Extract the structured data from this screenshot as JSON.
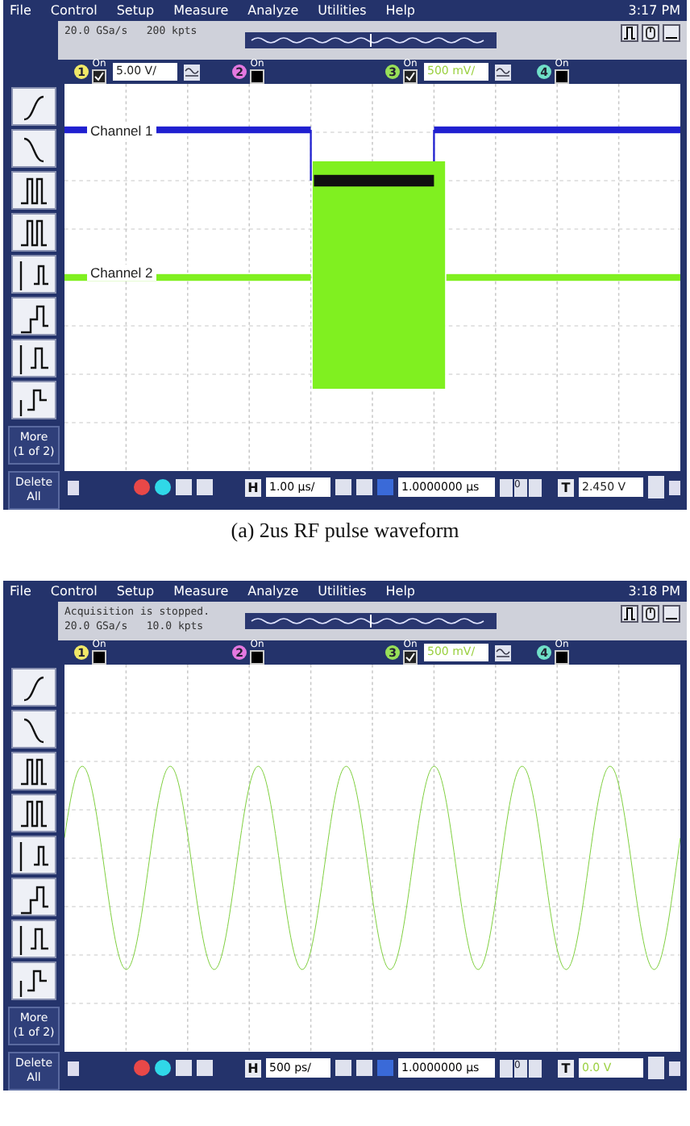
{
  "scopes": [
    {
      "menu": [
        "File",
        "Control",
        "Setup",
        "Measure",
        "Analyze",
        "Utilities",
        "Help"
      ],
      "time": "3:17 PM",
      "status_lines": [
        "20.0 GSa/s   200 kpts"
      ],
      "channels": [
        {
          "number": "1",
          "label": "On",
          "checked": true,
          "color": "#f0e868",
          "scale": {
            "text": "5.00 V/",
            "color": "#202020"
          }
        },
        {
          "number": "2",
          "label": "On",
          "checked": false,
          "color": "#e478e0"
        },
        {
          "number": "3",
          "label": "On",
          "checked": true,
          "color": "#98e058",
          "scale": {
            "text": "500 mV/",
            "color": "#9ad040"
          }
        },
        {
          "number": "4",
          "label": "On",
          "checked": false,
          "color": "#70e0c8"
        }
      ],
      "waveform": {
        "kind": "pulse"
      },
      "trace_labels": [
        "Channel 1",
        "Channel 2"
      ],
      "sidebar": {
        "more": "More\n(1 of 2)",
        "delete": "Delete\nAll"
      },
      "bottom": {
        "h_label": "H",
        "h_scale": "1.00 µs/",
        "delay": "1.0000000 µs",
        "zero": "0",
        "t_label": "T",
        "trigger_level": {
          "text": "2.450 V",
          "color": "#202020"
        }
      },
      "caption": "(a) 2us RF pulse waveform"
    },
    {
      "menu": [
        "File",
        "Control",
        "Setup",
        "Measure",
        "Analyze",
        "Utilities",
        "Help"
      ],
      "time": "3:18 PM",
      "status_lines": [
        "Acquisition is stopped.",
        "20.0 GSa/s   10.0 kpts"
      ],
      "channels": [
        {
          "number": "1",
          "label": "On",
          "checked": false,
          "color": "#f0e868"
        },
        {
          "number": "2",
          "label": "On",
          "checked": false,
          "color": "#e478e0"
        },
        {
          "number": "3",
          "label": "On",
          "checked": true,
          "color": "#98e058",
          "scale": {
            "text": "500 mV/",
            "color": "#9ad040"
          }
        },
        {
          "number": "4",
          "label": "On",
          "checked": false,
          "color": "#70e0c8"
        }
      ],
      "waveform": {
        "kind": "sine"
      },
      "sidebar": {
        "more": "More\n(1 of 2)",
        "delete": "Delete\nAll"
      },
      "bottom": {
        "h_label": "H",
        "h_scale": "500 ps/",
        "delay": "1.0000000 µs",
        "zero": "0",
        "t_label": "T",
        "trigger_level": {
          "text": "0.0 V",
          "color": "#9ad040"
        }
      }
    }
  ]
}
